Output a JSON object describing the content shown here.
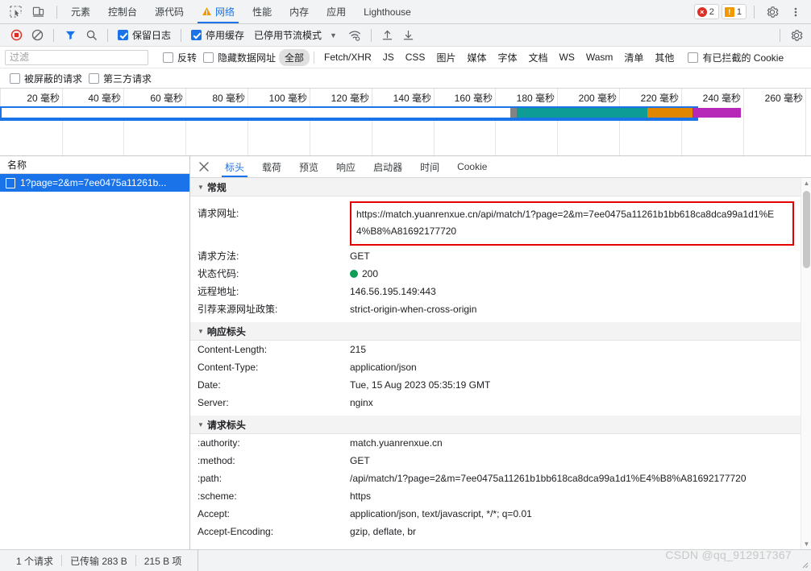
{
  "window": {
    "main_tabs": [
      {
        "label": "元素",
        "active": false,
        "warn": false
      },
      {
        "label": "控制台",
        "active": false,
        "warn": false
      },
      {
        "label": "源代码",
        "active": false,
        "warn": false
      },
      {
        "label": "网络",
        "active": true,
        "warn": true
      },
      {
        "label": "性能",
        "active": false,
        "warn": false
      },
      {
        "label": "内存",
        "active": false,
        "warn": false
      },
      {
        "label": "应用",
        "active": false,
        "warn": false
      },
      {
        "label": "Lighthouse",
        "active": false,
        "warn": false
      }
    ],
    "error_count": "2",
    "warning_count": "1",
    "inspect_icon": "inspect-element-icon",
    "device_icon": "device-toolbar-icon",
    "settings_icon": "gear-icon",
    "more_icon": "more-vertical-icon"
  },
  "network_toolbar": {
    "record_icon": "record-stop-icon",
    "clear_icon": "clear-icon",
    "filter_icon": "filter-icon",
    "search_icon": "search-icon",
    "preserve_log": {
      "label": "保留日志",
      "checked": true
    },
    "disable_cache": {
      "label": "停用缓存",
      "checked": true
    },
    "throttling": "已停用节流模式",
    "throttle_caret_icon": "chevron-down-icon",
    "wifi_icon": "network-conditions-icon",
    "import_icon": "import-har-icon",
    "export_icon": "export-har-icon",
    "settings_icon": "gear-icon"
  },
  "filter_bar": {
    "input_value": "",
    "placeholder": "过滤",
    "invert": {
      "label": "反转",
      "checked": false
    },
    "hide_data_urls": {
      "label": "隐藏数据网址",
      "checked": false
    },
    "types": [
      {
        "label": "全部",
        "selected": true
      },
      {
        "label": "Fetch/XHR",
        "selected": false
      },
      {
        "label": "JS",
        "selected": false
      },
      {
        "label": "CSS",
        "selected": false
      },
      {
        "label": "图片",
        "selected": false
      },
      {
        "label": "媒体",
        "selected": false
      },
      {
        "label": "字体",
        "selected": false
      },
      {
        "label": "文档",
        "selected": false
      },
      {
        "label": "WS",
        "selected": false
      },
      {
        "label": "Wasm",
        "selected": false
      },
      {
        "label": "清单",
        "selected": false
      },
      {
        "label": "其他",
        "selected": false
      }
    ],
    "blocked_cookies": {
      "label": "有已拦截的 Cookie",
      "checked": false
    },
    "blocked_requests": {
      "label": "被屏蔽的请求",
      "checked": false
    },
    "third_party": {
      "label": "第三方请求",
      "checked": false
    }
  },
  "overview": {
    "ticks": [
      "20 毫秒",
      "40 毫秒",
      "60 毫秒",
      "80 毫秒",
      "100 毫秒",
      "120 毫秒",
      "140 毫秒",
      "160 毫秒",
      "180 毫秒",
      "200 毫秒",
      "220 毫秒",
      "240 毫秒",
      "260 毫秒"
    ],
    "segments": [
      {
        "name": "blocked",
        "color": "#848484",
        "start_pct": 62.8,
        "width_pct": 0.8
      },
      {
        "name": "dns-ssl",
        "color": "#0e9d96",
        "start_pct": 63.6,
        "width_pct": 16.5
      },
      {
        "name": "connect",
        "color": "#e08600",
        "start_pct": 80.1,
        "width_pct": 5.6
      },
      {
        "name": "ssl",
        "color": "#b828b8",
        "start_pct": 85.7,
        "width_pct": 5.9
      },
      {
        "name": "waiting",
        "color": "#0c9d32",
        "start_pct": 91.6,
        "width_pct": 24.0
      }
    ]
  },
  "request_list": {
    "column_header": "名称",
    "rows": [
      {
        "name": "1?page=2&m=7ee0475a11261b...",
        "selected": true,
        "icon": "document-icon"
      }
    ]
  },
  "detail_panel": {
    "close_icon": "close-icon",
    "tabs": [
      {
        "label": "标头",
        "active": true
      },
      {
        "label": "载荷",
        "active": false
      },
      {
        "label": "预览",
        "active": false
      },
      {
        "label": "响应",
        "active": false
      },
      {
        "label": "启动器",
        "active": false
      },
      {
        "label": "时间",
        "active": false
      },
      {
        "label": "Cookie",
        "active": false
      }
    ],
    "sections": [
      {
        "title": "常规",
        "collapse_icon": "triangle-down-icon",
        "rows": [
          {
            "key": "请求网址:",
            "value": "https://match.yuanrenxue.cn/api/match/1?page=2&m=7ee0475a11261b1bb618ca8dca99a1d1%E4%B8%A81692177720",
            "highlighted": true
          },
          {
            "key": "请求方法:",
            "value": "GET"
          },
          {
            "key": "状态代码:",
            "value": "200",
            "status_dot": "#0f9d58"
          },
          {
            "key": "远程地址:",
            "value": "146.56.195.149:443"
          },
          {
            "key": "引荐来源网址政策:",
            "value": "strict-origin-when-cross-origin"
          }
        ]
      },
      {
        "title": "响应标头",
        "collapse_icon": "triangle-down-icon",
        "rows": [
          {
            "key": "Content-Length:",
            "value": "215"
          },
          {
            "key": "Content-Type:",
            "value": "application/json"
          },
          {
            "key": "Date:",
            "value": "Tue, 15 Aug 2023 05:35:19 GMT"
          },
          {
            "key": "Server:",
            "value": "nginx"
          }
        ]
      },
      {
        "title": "请求标头",
        "collapse_icon": "triangle-down-icon",
        "rows": [
          {
            "key": ":authority:",
            "value": "match.yuanrenxue.cn"
          },
          {
            "key": ":method:",
            "value": "GET"
          },
          {
            "key": ":path:",
            "value": "/api/match/1?page=2&m=7ee0475a11261b1bb618ca8dca99a1d1%E4%B8%A81692177720"
          },
          {
            "key": ":scheme:",
            "value": "https"
          },
          {
            "key": "Accept:",
            "value": "application/json, text/javascript, */*; q=0.01"
          },
          {
            "key": "Accept-Encoding:",
            "value": "gzip, deflate, br"
          }
        ]
      }
    ]
  },
  "status_bar": {
    "requests": "1 个请求",
    "transferred": "已传输 283 B",
    "resources": "215 B 项"
  },
  "watermark": "CSDN @qq_912917367",
  "colors": {
    "accent": "#1a73e8",
    "highlight_border": "#e50000",
    "status_ok": "#0f9d58",
    "error": "#d93025",
    "warning": "#f29900"
  }
}
